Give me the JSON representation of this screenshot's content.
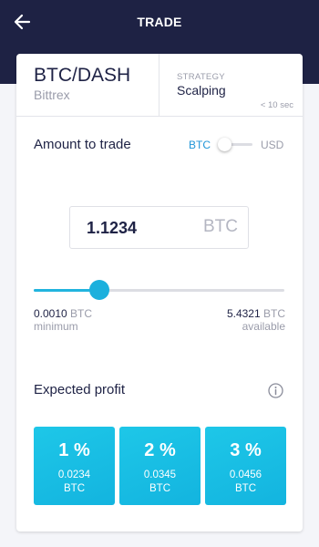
{
  "header": {
    "title": "TRADE"
  },
  "pair": {
    "name": "BTC/DASH",
    "exchange": "Bittrex"
  },
  "strategy": {
    "label": "STRATEGY",
    "value": "Scalping",
    "timeframe": "< 10 sec"
  },
  "amount": {
    "label": "Amount to trade",
    "toggle": {
      "left": "BTC",
      "right": "USD",
      "selected": "BTC"
    },
    "input": {
      "value": "1.1234",
      "unit": "BTC"
    }
  },
  "slider": {
    "position_fraction": 0.26,
    "min": {
      "value": "0.0010",
      "unit": "BTC",
      "caption": "minimum"
    },
    "max": {
      "value": "5.4321",
      "unit": "BTC",
      "caption": "available"
    }
  },
  "profit": {
    "label": "Expected profit",
    "options": [
      {
        "percent": "1 %",
        "value": "0.0234",
        "unit": "BTC"
      },
      {
        "percent": "2 %",
        "value": "0.0345",
        "unit": "BTC"
      },
      {
        "percent": "3 %",
        "value": "0.0456",
        "unit": "BTC"
      }
    ]
  },
  "colors": {
    "header_bg": "#1e2244",
    "accent": "#21b4de",
    "toggle_active": "#2196d8",
    "text_primary": "#1e2245",
    "text_muted": "#9a9caa"
  },
  "icons": {
    "back": "arrow-left-icon",
    "info": "info-circle-icon"
  }
}
